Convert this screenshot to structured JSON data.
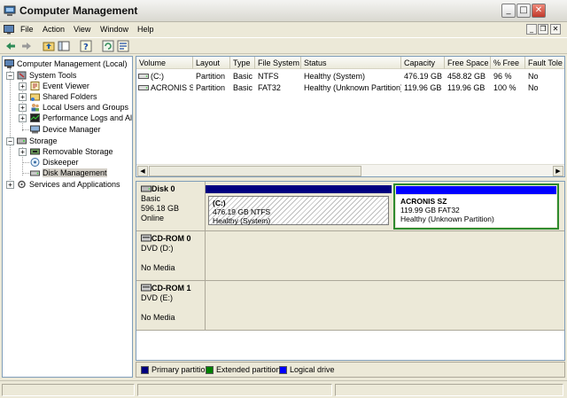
{
  "window": {
    "title": "Computer Management",
    "controls": {
      "minimize": "_",
      "maximize": "□",
      "close": "✕"
    },
    "close_color": "#c0392b"
  },
  "menu": {
    "items": [
      "File",
      "Action",
      "View",
      "Window",
      "Help"
    ],
    "mdi_controls": {
      "minimize": "_",
      "restore": "❐",
      "close": "✕"
    }
  },
  "tree": {
    "root": "Computer Management (Local)",
    "system_tools": {
      "label": "System Tools",
      "children": [
        "Event Viewer",
        "Shared Folders",
        "Local Users and Groups",
        "Performance Logs and Ale",
        "Device Manager"
      ]
    },
    "storage": {
      "label": "Storage",
      "children": [
        "Removable Storage",
        "Diskeeper",
        "Disk Management"
      ]
    },
    "services": "Services and Applications"
  },
  "volumes": {
    "columns": [
      "Volume",
      "Layout",
      "Type",
      "File System",
      "Status",
      "Capacity",
      "Free Space",
      "% Free",
      "Fault Tole"
    ],
    "rows": [
      {
        "volume": "(C:)",
        "layout": "Partition",
        "type": "Basic",
        "fs": "NTFS",
        "status": "Healthy (System)",
        "capacity": "476.19 GB",
        "free": "458.82 GB",
        "pct": "96 %",
        "fault": "No"
      },
      {
        "volume": "ACRONIS SZ",
        "layout": "Partition",
        "type": "Basic",
        "fs": "FAT32",
        "status": "Healthy (Unknown Partition)",
        "capacity": "119.96 GB",
        "free": "119.96 GB",
        "pct": "100 %",
        "fault": "No"
      }
    ]
  },
  "disks": {
    "disk0": {
      "name": "Disk 0",
      "type": "Basic",
      "size": "596.18 GB",
      "state": "Online",
      "partitions": [
        {
          "name": "(C:)",
          "detail": "476.19 GB NTFS",
          "status": "Healthy (System)"
        },
        {
          "name": "ACRONIS SZ",
          "detail": "119.99 GB FAT32",
          "status": "Healthy (Unknown Partition)"
        }
      ]
    },
    "cdrom0": {
      "name": "CD-ROM 0",
      "drive": "DVD (D:)",
      "media": "No Media"
    },
    "cdrom1": {
      "name": "CD-ROM 1",
      "drive": "DVD (E:)",
      "media": "No Media"
    }
  },
  "legend": {
    "items": [
      {
        "label": "Primary partition",
        "color": "#000080"
      },
      {
        "label": "Extended partition",
        "color": "#008000"
      },
      {
        "label": "Logical drive",
        "color": "#0000ff"
      }
    ]
  },
  "colors": {
    "primary_bar": "#000080",
    "logical_bar": "#0000ff",
    "selected_border": "#2e8b2e"
  }
}
